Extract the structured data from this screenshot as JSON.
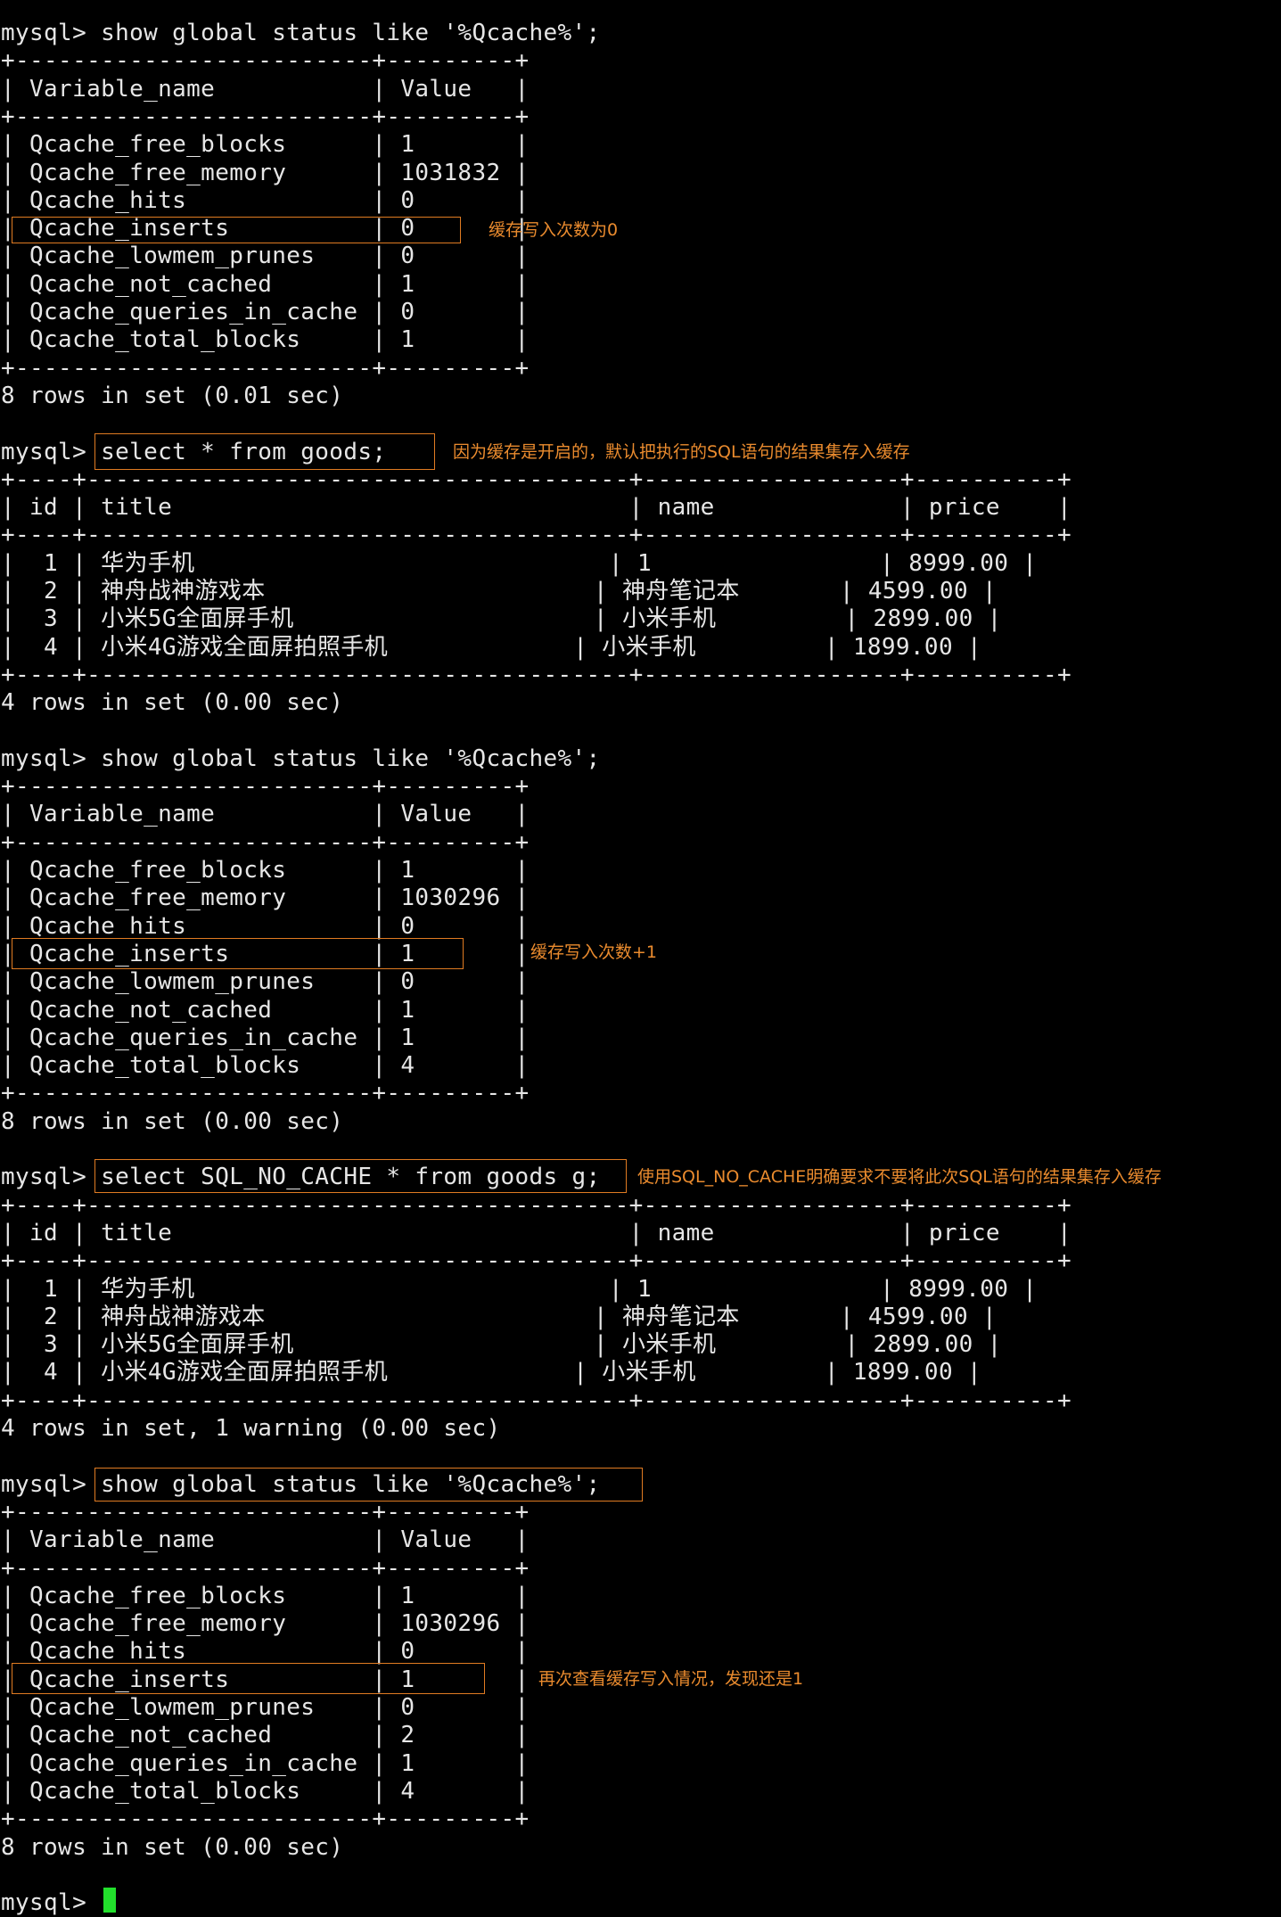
{
  "terminal": {
    "lines": [
      "mysql> show global status like '%Qcache%';",
      "+-------------------------+---------+",
      "| Variable_name           | Value   |",
      "+-------------------------+---------+",
      "| Qcache_free_blocks      | 1       |",
      "| Qcache_free_memory      | 1031832 |",
      "| Qcache_hits             | 0       |",
      "| Qcache_inserts          | 0       |",
      "| Qcache_lowmem_prunes    | 0       |",
      "| Qcache_not_cached       | 1       |",
      "| Qcache_queries_in_cache | 0       |",
      "| Qcache_total_blocks     | 1       |",
      "+-------------------------+---------+",
      "8 rows in set (0.01 sec)",
      "",
      "mysql> select * from goods;",
      "+----+--------------------------------------+------------------+----------+",
      "| id | title                                | name             | price    |",
      "+----+--------------------------------------+------------------+----------+",
      "|  1 | 华为手机                             | 1                | 8999.00 |",
      "|  2 | 神舟战神游戏本                       | 神舟笔记本       | 4599.00 |",
      "|  3 | 小米5G全面屏手机                     | 小米手机         | 2899.00 |",
      "|  4 | 小米4G游戏全面屏拍照手机             | 小米手机         | 1899.00 |",
      "+----+--------------------------------------+------------------+----------+",
      "4 rows in set (0.00 sec)",
      "",
      "mysql> show global status like '%Qcache%';",
      "+-------------------------+---------+",
      "| Variable_name           | Value   |",
      "+-------------------------+---------+",
      "| Qcache_free_blocks      | 1       |",
      "| Qcache_free_memory      | 1030296 |",
      "| Qcache_hits             | 0       |",
      "| Qcache_inserts          | 1       |",
      "| Qcache_lowmem_prunes    | 0       |",
      "| Qcache_not_cached       | 1       |",
      "| Qcache_queries_in_cache | 1       |",
      "| Qcache_total_blocks     | 4       |",
      "+-------------------------+---------+",
      "8 rows in set (0.00 sec)",
      "",
      "mysql> select SQL_NO_CACHE * from goods g;",
      "+----+--------------------------------------+------------------+----------+",
      "| id | title                                | name             | price    |",
      "+----+--------------------------------------+------------------+----------+",
      "|  1 | 华为手机                             | 1                | 8999.00 |",
      "|  2 | 神舟战神游戏本                       | 神舟笔记本       | 4599.00 |",
      "|  3 | 小米5G全面屏手机                     | 小米手机         | 2899.00 |",
      "|  4 | 小米4G游戏全面屏拍照手机             | 小米手机         | 1899.00 |",
      "+----+--------------------------------------+------------------+----------+",
      "4 rows in set, 1 warning (0.00 sec)",
      "",
      "mysql> show global status like '%Qcache%';",
      "+-------------------------+---------+",
      "| Variable_name           | Value   |",
      "+-------------------------+---------+",
      "| Qcache_free_blocks      | 1       |",
      "| Qcache_free_memory      | 1030296 |",
      "| Qcache_hits             | 0       |",
      "| Qcache_inserts          | 1       |",
      "| Qcache_lowmem_prunes    | 0       |",
      "| Qcache_not_cached       | 2       |",
      "| Qcache_queries_in_cache | 1       |",
      "| Qcache_total_blocks     | 4       |",
      "+-------------------------+---------+",
      "8 rows in set (0.00 sec)",
      "",
      "mysql> "
    ],
    "annotations": [
      "缓存写入次数为0",
      "因为缓存是开启的，默认把执行的SQL语句的结果集存入缓存",
      "缓存写入次数+1",
      "使用SQL_NO_CACHE明确要求不要将此次SQL语句的结果集存入缓存",
      "再次查看缓存写入情况，发现还是1"
    ],
    "colors": {
      "background": "#000000",
      "text": "#e6e6e6",
      "annotation": "#ea8b2e",
      "highlight_border": "#e07b22",
      "cursor": "#22e02c"
    }
  }
}
